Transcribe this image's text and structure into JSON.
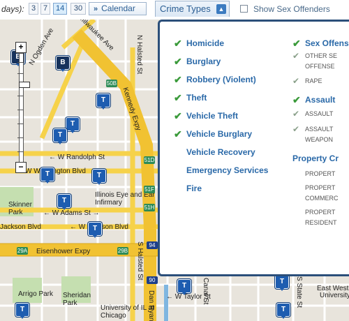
{
  "toolbar": {
    "days_label": "days):",
    "day_options": [
      "3",
      "7",
      "14",
      "30"
    ],
    "selected_days": "14",
    "calendar_label": "Calendar",
    "crime_types_label": "Crime Types",
    "show_sex_offenders_label": "Show Sex Offenders",
    "show_sex_offenders_checked": false
  },
  "map": {
    "street_labels": {
      "milwaukee": "Milwaukee Ave",
      "ogden": "N Ogden Ave",
      "halsted_n": "N Halsted St",
      "kennedy": "Kennedy Expy",
      "randolph": "W Randolph St",
      "washington": "W Washington Blvd",
      "adams": "W Adams St",
      "jackson": "W Jackson Blvd",
      "jackson_left": "Jackson Blvd",
      "eisenhower": "Eisenhower Expy",
      "halsted_s": "S Halsted St",
      "dan_ryan": "Dan Ryan",
      "taylor": "W Taylor St",
      "canal": "Canal St",
      "state": "S State St",
      "east_west": "East West",
      "university": "University"
    },
    "places": {
      "skinner_park": "Skinner Park",
      "illinois_eye": "Illinois Eye and Ear Infirmary",
      "arrigo_park": "Arrigo Park",
      "sheridan_park": "Sheridan Park",
      "uic": "University of IL at Chicago"
    },
    "shields": [
      "50B",
      "51D",
      "51F",
      "51H",
      "29A",
      "29B",
      "90",
      "94"
    ],
    "marker_letter_t": "T",
    "marker_letter_b": "B",
    "zoom_in": "+",
    "zoom_out": "−"
  },
  "crime_panel": {
    "left_column": [
      {
        "label": "Homicide",
        "checked": true
      },
      {
        "label": "Burglary",
        "checked": true
      },
      {
        "label": "Robbery (Violent)",
        "checked": true
      },
      {
        "label": "Theft",
        "checked": true
      },
      {
        "label": "Vehicle Theft",
        "checked": true
      },
      {
        "label": "Vehicle Burglary",
        "checked": true
      },
      {
        "label": "Vehicle Recovery",
        "checked": false
      },
      {
        "label": "Emergency Services",
        "checked": false
      },
      {
        "label": "Fire",
        "checked": false
      }
    ],
    "right_column": {
      "sex_offenses": {
        "label": "Sex Offenses",
        "checked": true,
        "subitems": [
          {
            "line1": "OTHER SE",
            "line2": "OFFENSE",
            "checked": true
          },
          {
            "line1": "RAPE",
            "line2": "",
            "checked": true
          }
        ]
      },
      "assault": {
        "label": "Assault",
        "checked": true,
        "subitems": [
          {
            "line1": "ASSAULT",
            "line2": "",
            "checked": true
          },
          {
            "line1": "ASSAULT",
            "line2": "WEAPON",
            "checked": true
          }
        ]
      },
      "property_crime": {
        "label": "Property Cr",
        "subitems": [
          {
            "line1": "PROPERT",
            "line2": ""
          },
          {
            "line1": "PROPERT",
            "line2": "COMMERC"
          },
          {
            "line1": "PROPERT",
            "line2": "RESIDENT"
          }
        ]
      }
    }
  },
  "colors": {
    "panel_border": "#2b4f7a",
    "link_blue": "#2a69a8",
    "check_green": "#3a9a3a",
    "highway_yellow": "#f6d24a",
    "map_background": "#e8e4dc"
  }
}
